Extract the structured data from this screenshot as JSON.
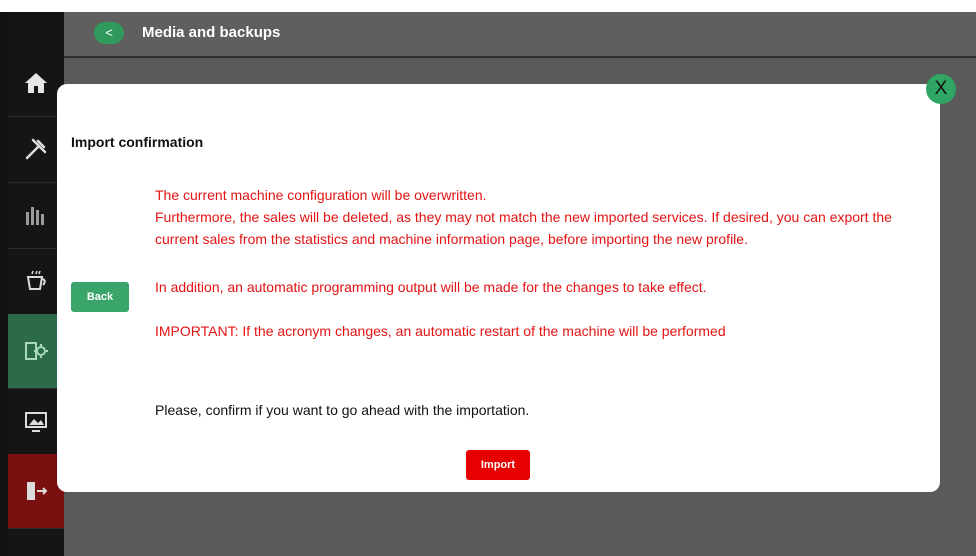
{
  "header": {
    "title": "Media and backups",
    "back_glyph": "<"
  },
  "sidebar": {
    "items": [
      {
        "icon": "home-icon"
      },
      {
        "icon": "tools-icon"
      },
      {
        "icon": "stats-icon"
      },
      {
        "icon": "cup-icon"
      },
      {
        "icon": "settings-export-icon",
        "active": true
      },
      {
        "icon": "display-icon"
      },
      {
        "icon": "exit-icon"
      }
    ]
  },
  "modal": {
    "title": "Import confirmation",
    "close_label": "X",
    "message_line1": "The current machine configuration will be overwritten.",
    "message_line2": "Furthermore, the sales will be deleted, as they may not match the new imported services. If desired, you can export the current sales from the statistics and machine information page, before importing the new profile.",
    "message_line3": "In addition, an automatic programming output will be made for the changes to take effect.",
    "message_line4": "IMPORTANT: If the acronym changes, an automatic restart of the machine will be performed",
    "confirm_text": "Please, confirm if you want to go ahead with the importation.",
    "back_label": "Back",
    "import_label": "Import"
  },
  "colors": {
    "warning_text": "#e31313",
    "accent_green": "#2fa663",
    "import_red": "#e60000"
  }
}
